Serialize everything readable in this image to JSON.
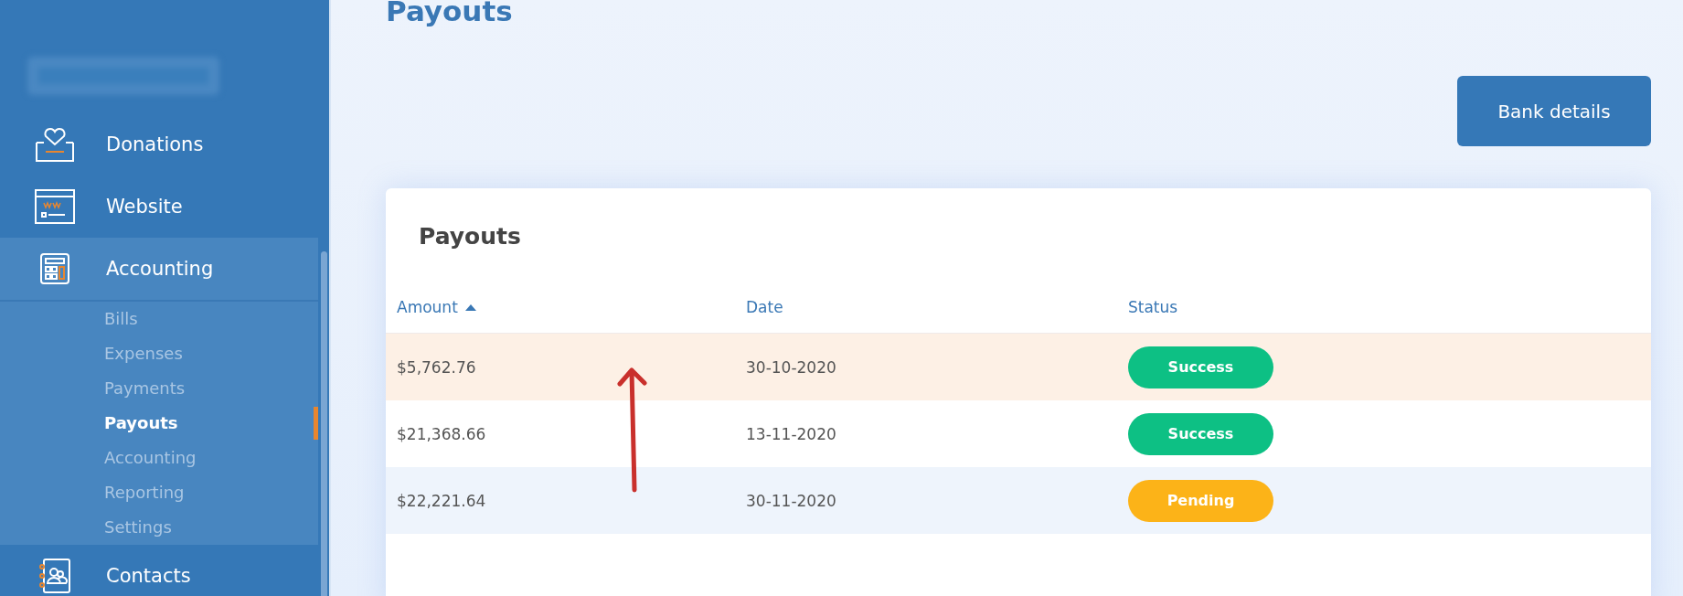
{
  "sidebar": {
    "items": [
      {
        "label": "Donations",
        "expanded": false
      },
      {
        "label": "Website",
        "expanded": false
      },
      {
        "label": "Accounting",
        "expanded": true,
        "children": [
          {
            "label": "Bills",
            "selected": false
          },
          {
            "label": "Expenses",
            "selected": false
          },
          {
            "label": "Payments",
            "selected": false
          },
          {
            "label": "Payouts",
            "selected": true
          },
          {
            "label": "Accounting",
            "selected": false
          },
          {
            "label": "Reporting",
            "selected": false
          },
          {
            "label": "Settings",
            "selected": false
          }
        ]
      },
      {
        "label": "Contacts",
        "expanded": false
      }
    ]
  },
  "page_title": "Payouts",
  "bank_details_button": "Bank details",
  "card": {
    "title": "Payouts",
    "table": {
      "columns": [
        {
          "label": "Amount",
          "sorted_ascending": true
        },
        {
          "label": "Date",
          "sorted_ascending": false
        },
        {
          "label": "Status",
          "sorted_ascending": false
        }
      ],
      "rows": [
        {
          "amount": "$5,762.76",
          "date": "30-10-2020",
          "status": "Success",
          "color": "#0dc084",
          "selected": true
        },
        {
          "amount": "$21,368.66",
          "date": "13-11-2020",
          "status": "Success",
          "color": "#0dc084",
          "selected": false
        },
        {
          "amount": "$22,221.64",
          "date": "30-11-2020",
          "status": "Pending",
          "color": "#fcb318",
          "selected": false
        }
      ]
    }
  }
}
